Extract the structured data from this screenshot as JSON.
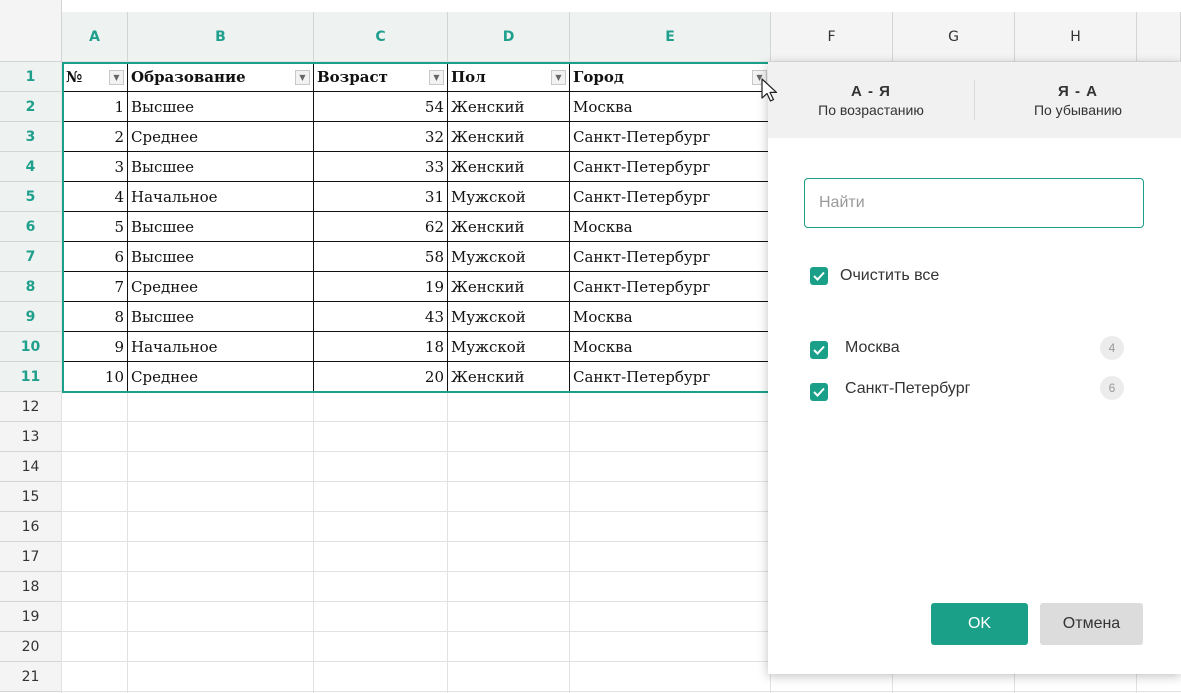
{
  "columns": [
    {
      "letter": "A",
      "selected": true
    },
    {
      "letter": "B",
      "selected": true
    },
    {
      "letter": "C",
      "selected": true
    },
    {
      "letter": "D",
      "selected": true
    },
    {
      "letter": "E",
      "selected": true
    },
    {
      "letter": "F",
      "selected": false
    },
    {
      "letter": "G",
      "selected": false
    },
    {
      "letter": "H",
      "selected": false
    }
  ],
  "rows": [
    "1",
    "2",
    "3",
    "4",
    "5",
    "6",
    "7",
    "8",
    "9",
    "10",
    "11",
    "12",
    "13",
    "14",
    "15",
    "16",
    "17",
    "18",
    "19",
    "20",
    "21"
  ],
  "selected_rows": [
    "1",
    "2",
    "3",
    "4",
    "5",
    "6",
    "7",
    "8",
    "9",
    "10",
    "11"
  ],
  "table": {
    "headers": [
      "№",
      "Образование",
      "Возраст",
      "Пол",
      "Город"
    ],
    "data": [
      [
        "1",
        "Высшее",
        "54",
        "Женский",
        "Москва"
      ],
      [
        "2",
        "Среднее",
        "32",
        "Женский",
        "Санкт-Петербург"
      ],
      [
        "3",
        "Высшее",
        "33",
        "Женский",
        "Санкт-Петербург"
      ],
      [
        "4",
        "Начальное",
        "31",
        "Мужской",
        "Санкт-Петербург"
      ],
      [
        "5",
        "Высшее",
        "62",
        "Женский",
        "Москва"
      ],
      [
        "6",
        "Высшее",
        "58",
        "Мужской",
        "Санкт-Петербург"
      ],
      [
        "7",
        "Среднее",
        "19",
        "Женский",
        "Санкт-Петербург"
      ],
      [
        "8",
        "Высшее",
        "43",
        "Мужской",
        "Москва"
      ],
      [
        "9",
        "Начальное",
        "18",
        "Мужской",
        "Москва"
      ],
      [
        "10",
        "Среднее",
        "20",
        "Женский",
        "Санкт-Петербург"
      ]
    ]
  },
  "filter_panel": {
    "sort_asc": {
      "title": "А - Я",
      "subtitle": "По возрастанию"
    },
    "sort_desc": {
      "title": "Я - А",
      "subtitle": "По убыванию"
    },
    "search_placeholder": "Найти",
    "clear_all_label": "Очистить все",
    "items": [
      {
        "label": "Москва",
        "count": "4",
        "checked": true
      },
      {
        "label": "Санкт-Петербург",
        "count": "6",
        "checked": true
      }
    ],
    "ok_label": "OK",
    "cancel_label": "Отмена"
  },
  "colors": {
    "accent": "#1aa088"
  }
}
